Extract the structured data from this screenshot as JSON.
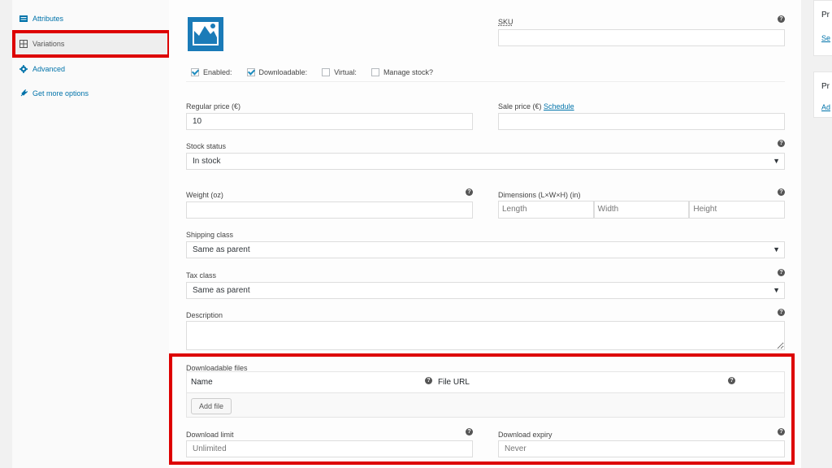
{
  "sidebar": {
    "items": [
      {
        "label": "Attributes",
        "icon": "list-icon"
      },
      {
        "label": "Variations",
        "icon": "grid-icon"
      },
      {
        "label": "Advanced",
        "icon": "gear-icon"
      },
      {
        "label": "Get more options",
        "icon": "plugin-icon"
      }
    ]
  },
  "variation": {
    "sku_label": "SKU",
    "sku_value": "",
    "checkboxes": [
      {
        "label": "Enabled:",
        "checked": true
      },
      {
        "label": "Downloadable:",
        "checked": true
      },
      {
        "label": "Virtual:",
        "checked": false
      },
      {
        "label": "Manage stock?",
        "checked": false
      }
    ],
    "regular_price_label": "Regular price (€)",
    "regular_price_value": "10",
    "sale_price_label": "Sale price (€)",
    "schedule_link": "Schedule",
    "sale_price_value": "",
    "stock_status_label": "Stock status",
    "stock_status_value": "In stock",
    "weight_label": "Weight (oz)",
    "weight_value": "",
    "dimensions_label": "Dimensions (L×W×H) (in)",
    "dim_length_placeholder": "Length",
    "dim_width_placeholder": "Width",
    "dim_height_placeholder": "Height",
    "shipping_class_label": "Shipping class",
    "shipping_class_value": "Same as parent",
    "tax_class_label": "Tax class",
    "tax_class_value": "Same as parent",
    "description_label": "Description",
    "downloadable_files_label": "Downloadable files",
    "files_col_name": "Name",
    "files_col_url": "File URL",
    "add_file_button": "Add file",
    "download_limit_label": "Download limit",
    "download_limit_placeholder": "Unlimited",
    "download_expiry_label": "Download expiry",
    "download_expiry_placeholder": "Never"
  },
  "right_panel": {
    "box1_heading": "Pr",
    "box1_link": "Se",
    "box2_heading": "Pr",
    "box2_link": "Ad"
  },
  "colors": {
    "highlight": "#dd0000",
    "link": "#0073aa",
    "checkbox_tick": "#1e8cbe"
  }
}
